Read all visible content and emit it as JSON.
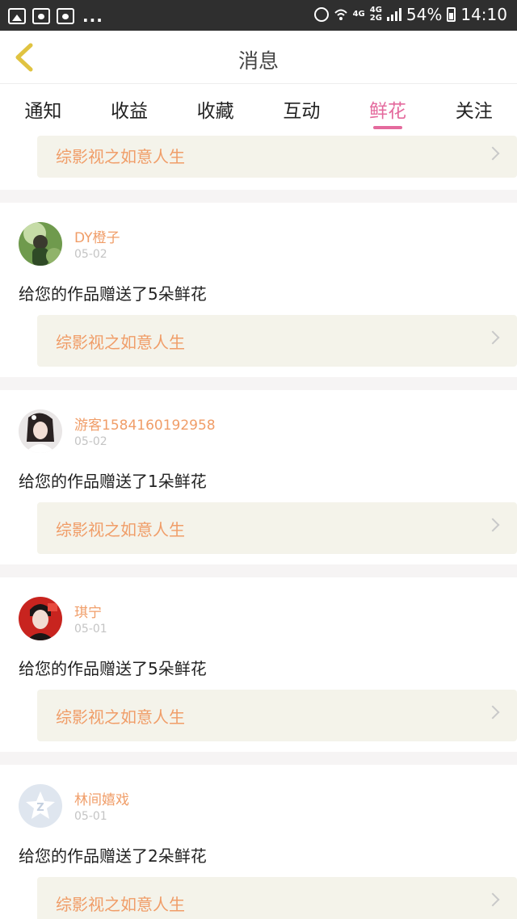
{
  "status_bar": {
    "dots": "...",
    "net_top": "4G",
    "net_mid_top": "4G",
    "net_mid_bot": "2G",
    "battery": "54%",
    "time": "14:10"
  },
  "header": {
    "title": "消息"
  },
  "tabs": [
    {
      "label": "通知"
    },
    {
      "label": "收益"
    },
    {
      "label": "收藏"
    },
    {
      "label": "互动"
    },
    {
      "label": "鲜花",
      "active": true
    },
    {
      "label": "关注"
    }
  ],
  "partial_top": {
    "work_title": "综影视之如意人生"
  },
  "items": [
    {
      "user": "DY橙子",
      "date": "05-02",
      "message": "给您的作品赠送了5朵鲜花",
      "work_title": "综影视之如意人生"
    },
    {
      "user": "游客1584160192958",
      "date": "05-02",
      "message": "给您的作品赠送了1朵鲜花",
      "work_title": "综影视之如意人生"
    },
    {
      "user": "琪宁",
      "date": "05-01",
      "message": "给您的作品赠送了5朵鲜花",
      "work_title": "综影视之如意人生"
    },
    {
      "user": "林间嬉戏",
      "date": "05-01",
      "message": "给您的作品赠送了2朵鲜花",
      "work_title": "综影视之如意人生"
    }
  ],
  "colors": {
    "accent_pink": "#e46a9d",
    "accent_orange": "#f09d68",
    "back_arrow": "#e0c341"
  }
}
